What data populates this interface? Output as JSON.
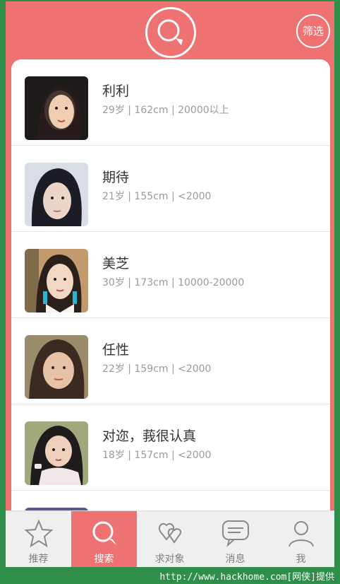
{
  "header": {
    "logo_icon": "search-magnifier-logo-icon",
    "filter_label": "筛选"
  },
  "profiles": [
    {
      "name": "利利",
      "meta": "29岁 | 162cm | 20000以上",
      "avatar_color": "#3a2a2a"
    },
    {
      "name": "期待",
      "meta": "21岁 | 155cm | <2000",
      "avatar_color": "#6a6a84"
    },
    {
      "name": "美芝",
      "meta": "30岁 | 173cm | 10000-20000",
      "avatar_color": "#b58b62"
    },
    {
      "name": "任性",
      "meta": "22岁 | 159cm | <2000",
      "avatar_color": "#8b7a5e"
    },
    {
      "name": "对迩，莪很认真",
      "meta": "18岁 | 157cm | <2000",
      "avatar_color": "#7b8a5a"
    }
  ],
  "tabs": [
    {
      "label": "推荐",
      "icon": "star-icon"
    },
    {
      "label": "搜索",
      "icon": "search-icon"
    },
    {
      "label": "求对象",
      "icon": "hearts-icon"
    },
    {
      "label": "消息",
      "icon": "chat-bubble-icon"
    },
    {
      "label": "我",
      "icon": "user-icon"
    }
  ],
  "watermark": "http://www.hackhome.com[网侠]提供",
  "colors": {
    "accent": "#ef7272",
    "footer": "#2f8e4a"
  }
}
